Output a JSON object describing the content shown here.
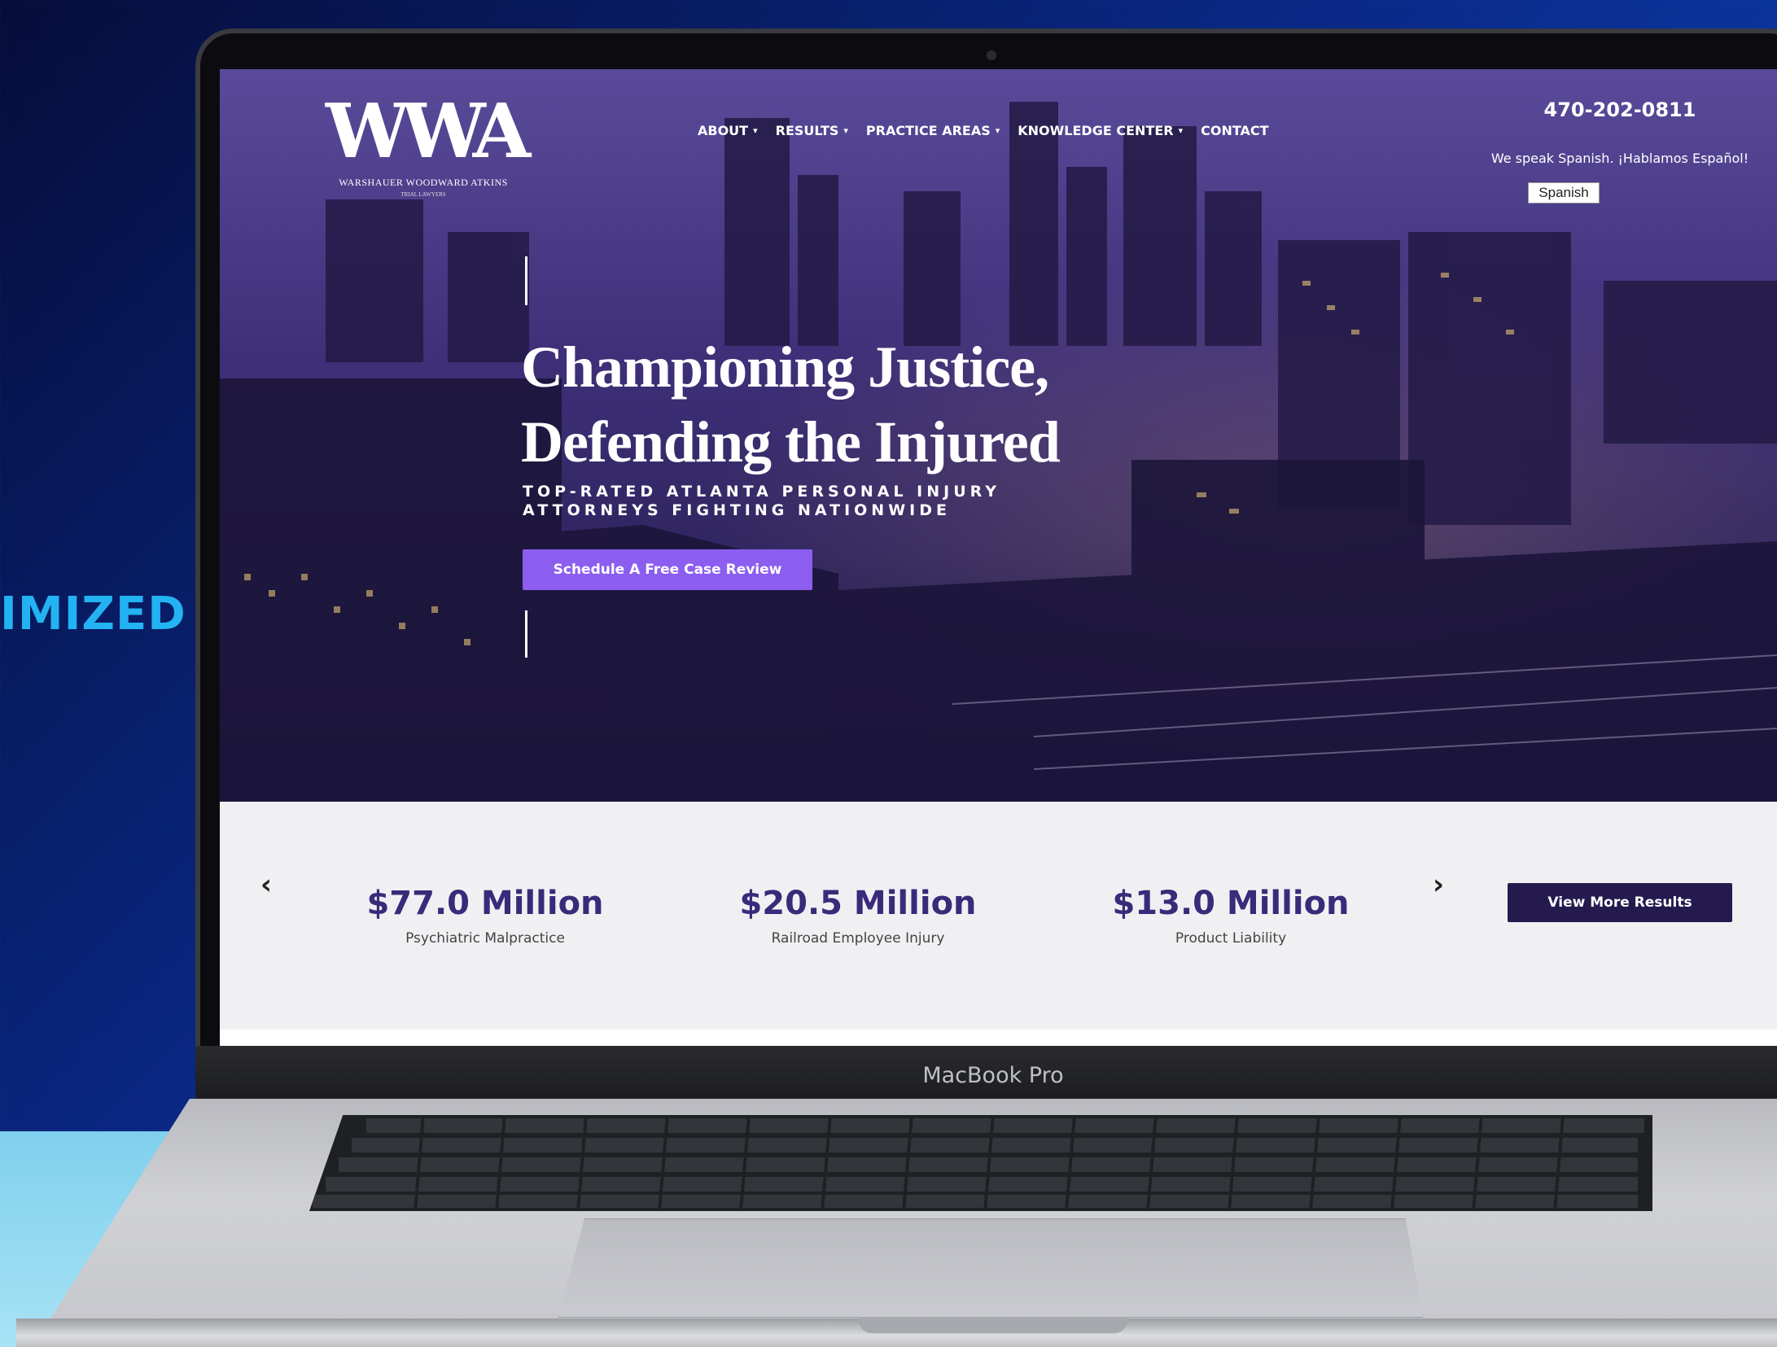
{
  "side_label": "IMIZED",
  "device_label": "MacBook Pro",
  "website": {
    "logo": {
      "mark": "WWA",
      "firm_name": "WARSHAUER WOODWARD ATKINS",
      "tagline": "TRIAL LAWYERS"
    },
    "nav": [
      {
        "label": "ABOUT",
        "has_dropdown": true
      },
      {
        "label": "RESULTS",
        "has_dropdown": true
      },
      {
        "label": "PRACTICE AREAS",
        "has_dropdown": true
      },
      {
        "label": "KNOWLEDGE CENTER",
        "has_dropdown": true
      },
      {
        "label": "CONTACT",
        "has_dropdown": false
      }
    ],
    "phone": "470-202-0811",
    "spanish_note": "We speak Spanish. ¡Hablamos Español!",
    "spanish_button": "Spanish",
    "hero": {
      "headline_line1": "Championing Justice,",
      "headline_line2": "Defending the Injured",
      "subhead_line1": "TOP-RATED ATLANTA PERSONAL INJURY",
      "subhead_line2": "ATTORNEYS FIGHTING NATIONWIDE",
      "cta": "Schedule A Free Case Review"
    },
    "results": {
      "items": [
        {
          "amount": "$77.0 Million",
          "type": "Psychiatric Malpractice"
        },
        {
          "amount": "$20.5 Million",
          "type": "Railroad Employee Injury"
        },
        {
          "amount": "$13.0 Million",
          "type": "Product Liability"
        }
      ],
      "prev_arrow": "‹",
      "next_arrow": "›",
      "more_button": "View More Results"
    }
  },
  "colors": {
    "accent_purple": "#8c5ef0",
    "dark_purple": "#241a4e",
    "amount_purple": "#3a2a7a",
    "side_text": "#23b2f2"
  }
}
